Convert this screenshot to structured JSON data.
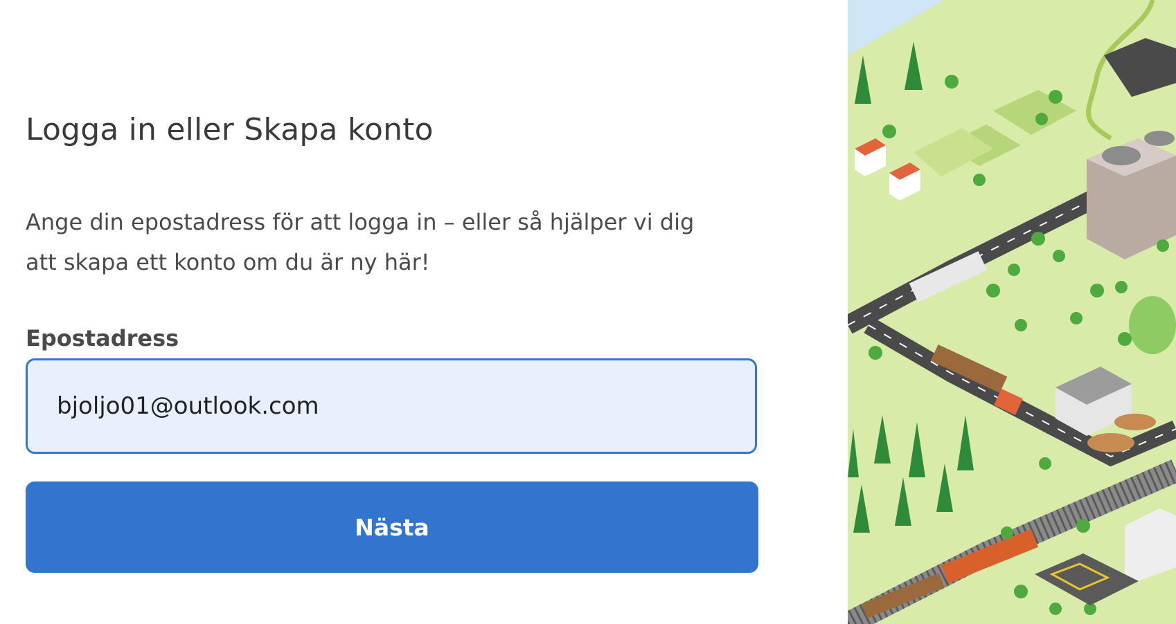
{
  "login": {
    "title": "Logga in eller Skapa konto",
    "description": "Ange din epostadress för att logga in – eller så hjälper vi dig att skapa ett konto om du är ny här!",
    "email_label": "Epostadress",
    "email_value": "bjoljo01@outlook.com",
    "next_button": "Nästa"
  },
  "colors": {
    "accent": "#3275cf",
    "input_bg": "#e8f0fd",
    "title": "#3a3a3a",
    "grass": "#d8eba8",
    "road": "#4a4a4a"
  },
  "illustration": {
    "icon": "isometric-landscape-illustration"
  }
}
